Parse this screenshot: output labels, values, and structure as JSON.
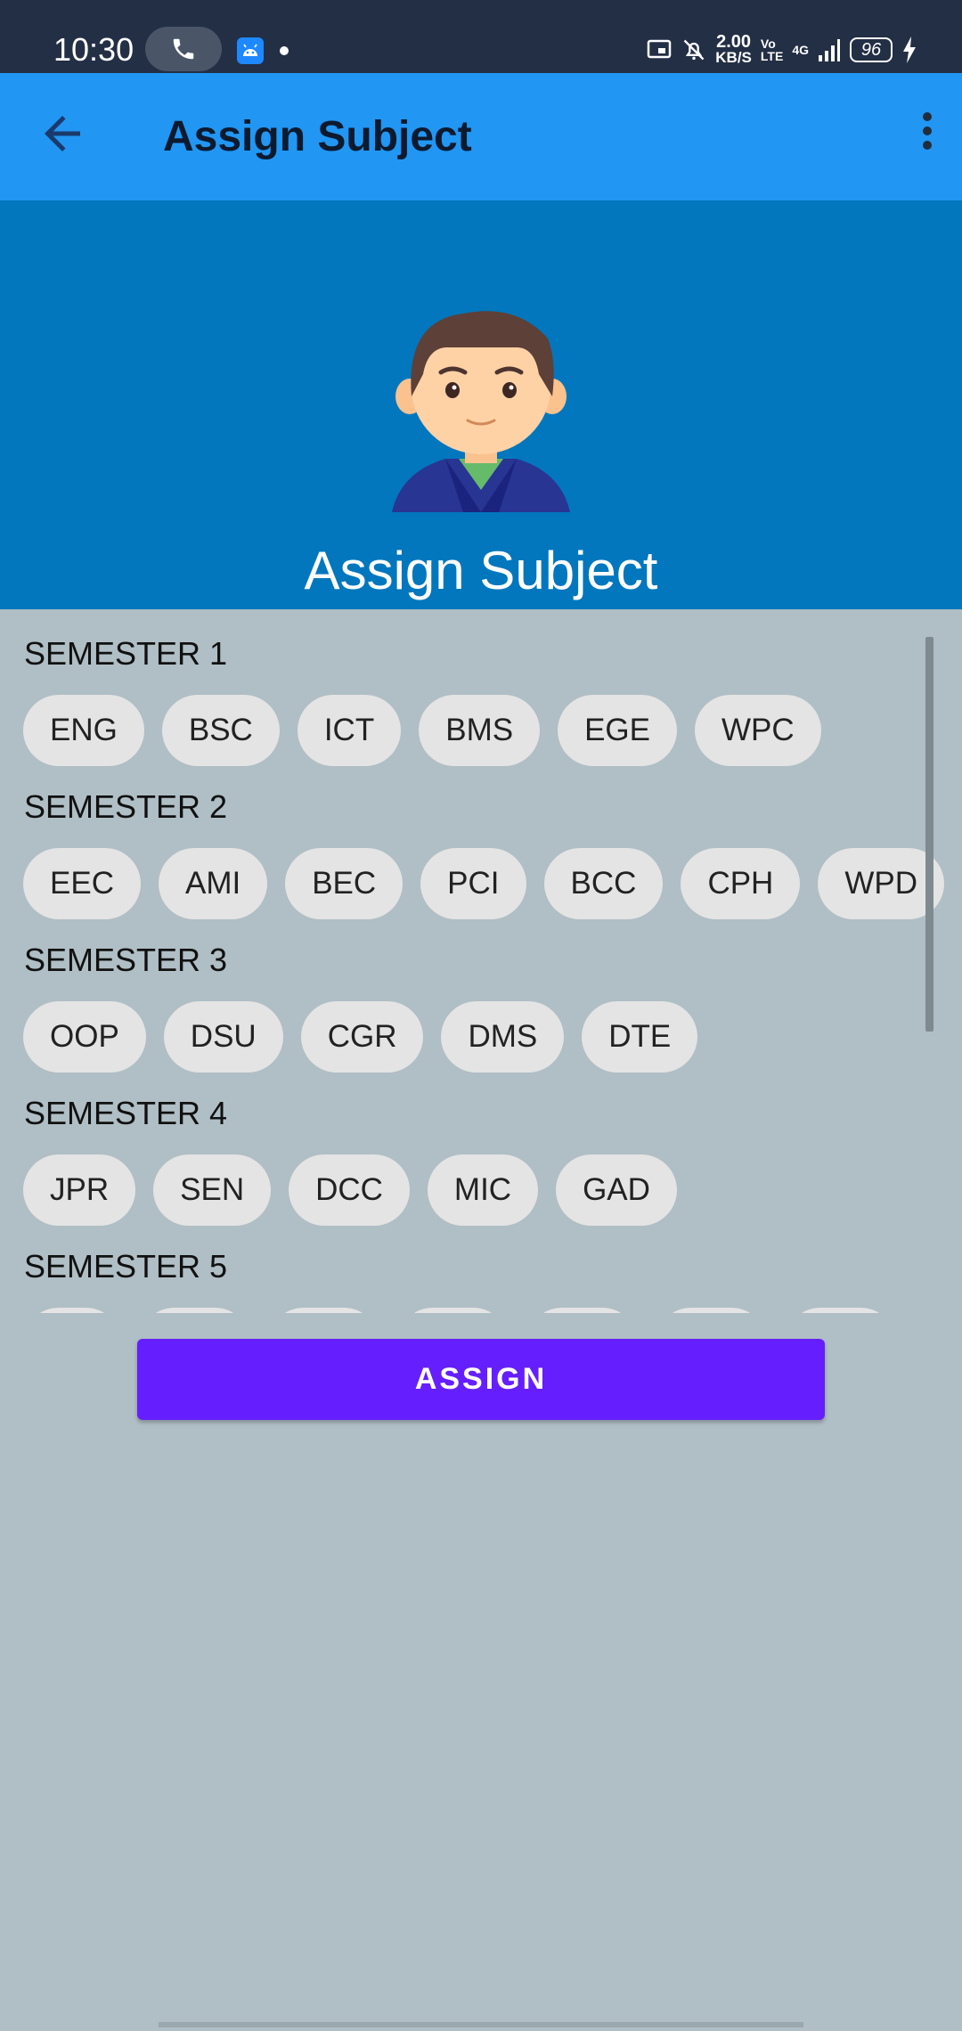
{
  "status_bar": {
    "time": "10:30",
    "net_speed_value": "2.00",
    "net_speed_unit": "KB/S",
    "volte_label_top": "Vo",
    "volte_label_bottom": "LTE",
    "network_label": "4G",
    "battery": "96",
    "icons": [
      "phone-icon",
      "app-notification-icon",
      "cast-icon",
      "mute-bell-icon",
      "signal-icon",
      "charging-icon"
    ]
  },
  "app_bar": {
    "title": "Assign Subject",
    "back_icon": "arrow-left-icon",
    "menu_icon": "more-vert-icon"
  },
  "header": {
    "title": "Assign Subject",
    "avatar": "male-avatar"
  },
  "semesters": [
    {
      "label": "SEMESTER 1",
      "subjects": [
        "ENG",
        "BSC",
        "ICT",
        "BMS",
        "EGE",
        "WPC"
      ]
    },
    {
      "label": "SEMESTER 2",
      "subjects": [
        "EEC",
        "AMI",
        "BEC",
        "PCI",
        "BCC",
        "CPH",
        "WPD"
      ]
    },
    {
      "label": "SEMESTER 3",
      "subjects": [
        "OOP",
        "DSU",
        "CGR",
        "DMS",
        "DTE"
      ]
    },
    {
      "label": "SEMESTER 4",
      "subjects": [
        "JPR",
        "SEN",
        "DCC",
        "MIC",
        "GAD"
      ]
    },
    {
      "label": "SEMESTER 5",
      "subjects": []
    }
  ],
  "assign_button": {
    "label": "ASSIGN"
  },
  "colors": {
    "status_bar": "#232f45",
    "app_bar": "#2196f3",
    "header": "#0277bd",
    "background": "#b0bec5",
    "chip": "#e4e4e4",
    "button": "#651fff"
  }
}
